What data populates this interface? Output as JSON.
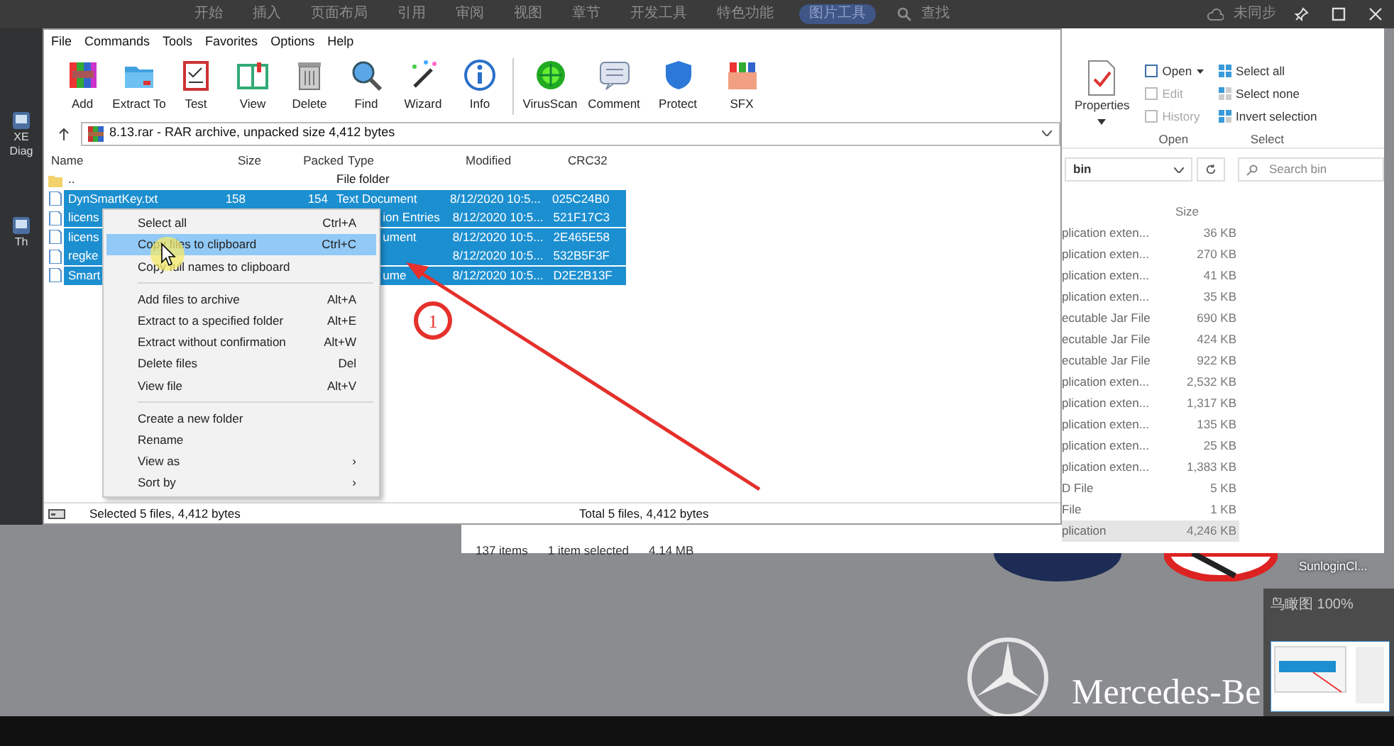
{
  "wps_bar": {
    "tabs": [
      {
        "label": "开始",
        "selected": false
      },
      {
        "label": "插入",
        "selected": false
      },
      {
        "label": "页面布局",
        "selected": false
      },
      {
        "label": "引用",
        "selected": false
      },
      {
        "label": "审阅",
        "selected": false
      },
      {
        "label": "视图",
        "selected": false
      },
      {
        "label": "章节",
        "selected": false
      },
      {
        "label": "开发工具",
        "selected": false
      },
      {
        "label": "特色功能",
        "selected": false
      },
      {
        "label": "图片工具",
        "selected": true
      }
    ],
    "search": "查找",
    "sync": "未同步"
  },
  "desktop_icons": [
    {
      "lines": [
        "XE",
        "Diag"
      ]
    },
    {
      "lines": [
        "Th"
      ]
    }
  ],
  "explorer": {
    "properties": "Properties",
    "open_group": {
      "title": "Open",
      "items": [
        {
          "label": "Open",
          "disabled": false,
          "dropdown": true
        },
        {
          "label": "Edit",
          "disabled": true,
          "dropdown": false
        },
        {
          "label": "History",
          "disabled": true,
          "dropdown": false
        }
      ]
    },
    "select_group": {
      "title": "Select",
      "items": [
        "Select all",
        "Select none",
        "Invert selection"
      ]
    },
    "location": "bin",
    "search": {
      "placeholder": "Search bin"
    },
    "size_header": "Size",
    "rows": [
      {
        "type": "plication exten...",
        "size": "36 KB",
        "selected": false
      },
      {
        "type": "plication exten...",
        "size": "270 KB",
        "selected": false
      },
      {
        "type": "plication exten...",
        "size": "41 KB",
        "selected": false
      },
      {
        "type": "plication exten...",
        "size": "35 KB",
        "selected": false
      },
      {
        "type": "ecutable Jar File",
        "size": "690 KB",
        "selected": false
      },
      {
        "type": "ecutable Jar File",
        "size": "424 KB",
        "selected": false
      },
      {
        "type": "ecutable Jar File",
        "size": "922 KB",
        "selected": false
      },
      {
        "type": "plication exten...",
        "size": "2,532 KB",
        "selected": false
      },
      {
        "type": "plication exten...",
        "size": "1,317 KB",
        "selected": false
      },
      {
        "type": "plication exten...",
        "size": "135 KB",
        "selected": false
      },
      {
        "type": "plication exten...",
        "size": "25 KB",
        "selected": false
      },
      {
        "type": "plication exten...",
        "size": "1,383 KB",
        "selected": false
      },
      {
        "type": "D File",
        "size": "5 KB",
        "selected": false
      },
      {
        "type": "File",
        "size": "1 KB",
        "selected": false
      },
      {
        "type": "plication",
        "size": "4,246 KB",
        "selected": true
      }
    ],
    "status": [
      "137 items",
      "1 item selected",
      "4.14 MB"
    ]
  },
  "winrar": {
    "menu": [
      "File",
      "Commands",
      "Tools",
      "Favorites",
      "Options",
      "Help"
    ],
    "toolbar": [
      "Add",
      "Extract To",
      "Test",
      "View",
      "Delete",
      "Find",
      "Wizard",
      "Info",
      "VirusScan",
      "Comment",
      "Protect",
      "SFX"
    ],
    "path": "8.13.rar - RAR archive, unpacked size 4,412 bytes",
    "columns": [
      "Name",
      "Size",
      "Packed",
      "Type",
      "Modified",
      "CRC32"
    ],
    "rows": [
      {
        "kind": "folder",
        "name": "..",
        "type": "File folder",
        "selected": false
      },
      {
        "kind": "full",
        "name": "DynSmartKey.txt",
        "size": "158",
        "packed": "154",
        "type": "Text Document",
        "modified": "8/12/2020 10:5...",
        "crc32": "025C24B0",
        "selected": true
      },
      {
        "kind": "clipped",
        "name": "licens",
        "type": "ion Entries",
        "modified": "8/12/2020 10:5...",
        "crc32": "521F17C3",
        "selected": true
      },
      {
        "kind": "clipped",
        "name": "licens",
        "type": "ument",
        "modified": "8/12/2020 10:5...",
        "crc32": "2E465E58",
        "selected": true
      },
      {
        "kind": "clipped",
        "name": "regke",
        "modified": "8/12/2020 10:5...",
        "crc32": "532B5F3F",
        "selected": true
      },
      {
        "kind": "clipped",
        "name": "Smart",
        "type": "ume",
        "modified": "8/12/2020 10:5...",
        "crc32": "D2E2B13F",
        "selected": true
      }
    ],
    "status_left": "Selected 5 files, 4,412 bytes",
    "status_right": "Total 5 files, 4,412 bytes"
  },
  "context_menu": [
    {
      "kind": "item",
      "label": "Select all",
      "shortcut": "Ctrl+A",
      "selected": false
    },
    {
      "kind": "item",
      "label": "Copy files to clipboard",
      "shortcut": "Ctrl+C",
      "selected": true
    },
    {
      "kind": "item",
      "label": "Copy full names to clipboard",
      "selected": false
    },
    {
      "kind": "separator"
    },
    {
      "kind": "item",
      "label": "Add files to archive",
      "shortcut": "Alt+A",
      "selected": false
    },
    {
      "kind": "item",
      "label": "Extract to a specified folder",
      "shortcut": "Alt+E",
      "selected": false
    },
    {
      "kind": "item",
      "label": "Extract without confirmation",
      "shortcut": "Alt+W",
      "selected": false
    },
    {
      "kind": "item",
      "label": "Delete files",
      "shortcut": "Del",
      "selected": false
    },
    {
      "kind": "item",
      "label": "View file",
      "shortcut": "Alt+V",
      "selected": false
    },
    {
      "kind": "separator"
    },
    {
      "kind": "item",
      "label": "Create a new folder",
      "selected": false
    },
    {
      "kind": "item",
      "label": "Rename",
      "selected": false
    },
    {
      "kind": "item",
      "label": "View as",
      "arrow": "›",
      "selected": false
    },
    {
      "kind": "item",
      "label": "Sort by",
      "arrow": "›",
      "selected": false
    }
  ],
  "annotation": {
    "number": "1"
  },
  "desktop": {
    "app_label": "SunloginCl...",
    "brand_text": "Mercedes-Be"
  },
  "overview_popup": {
    "title": "鸟瞰图 100%"
  }
}
